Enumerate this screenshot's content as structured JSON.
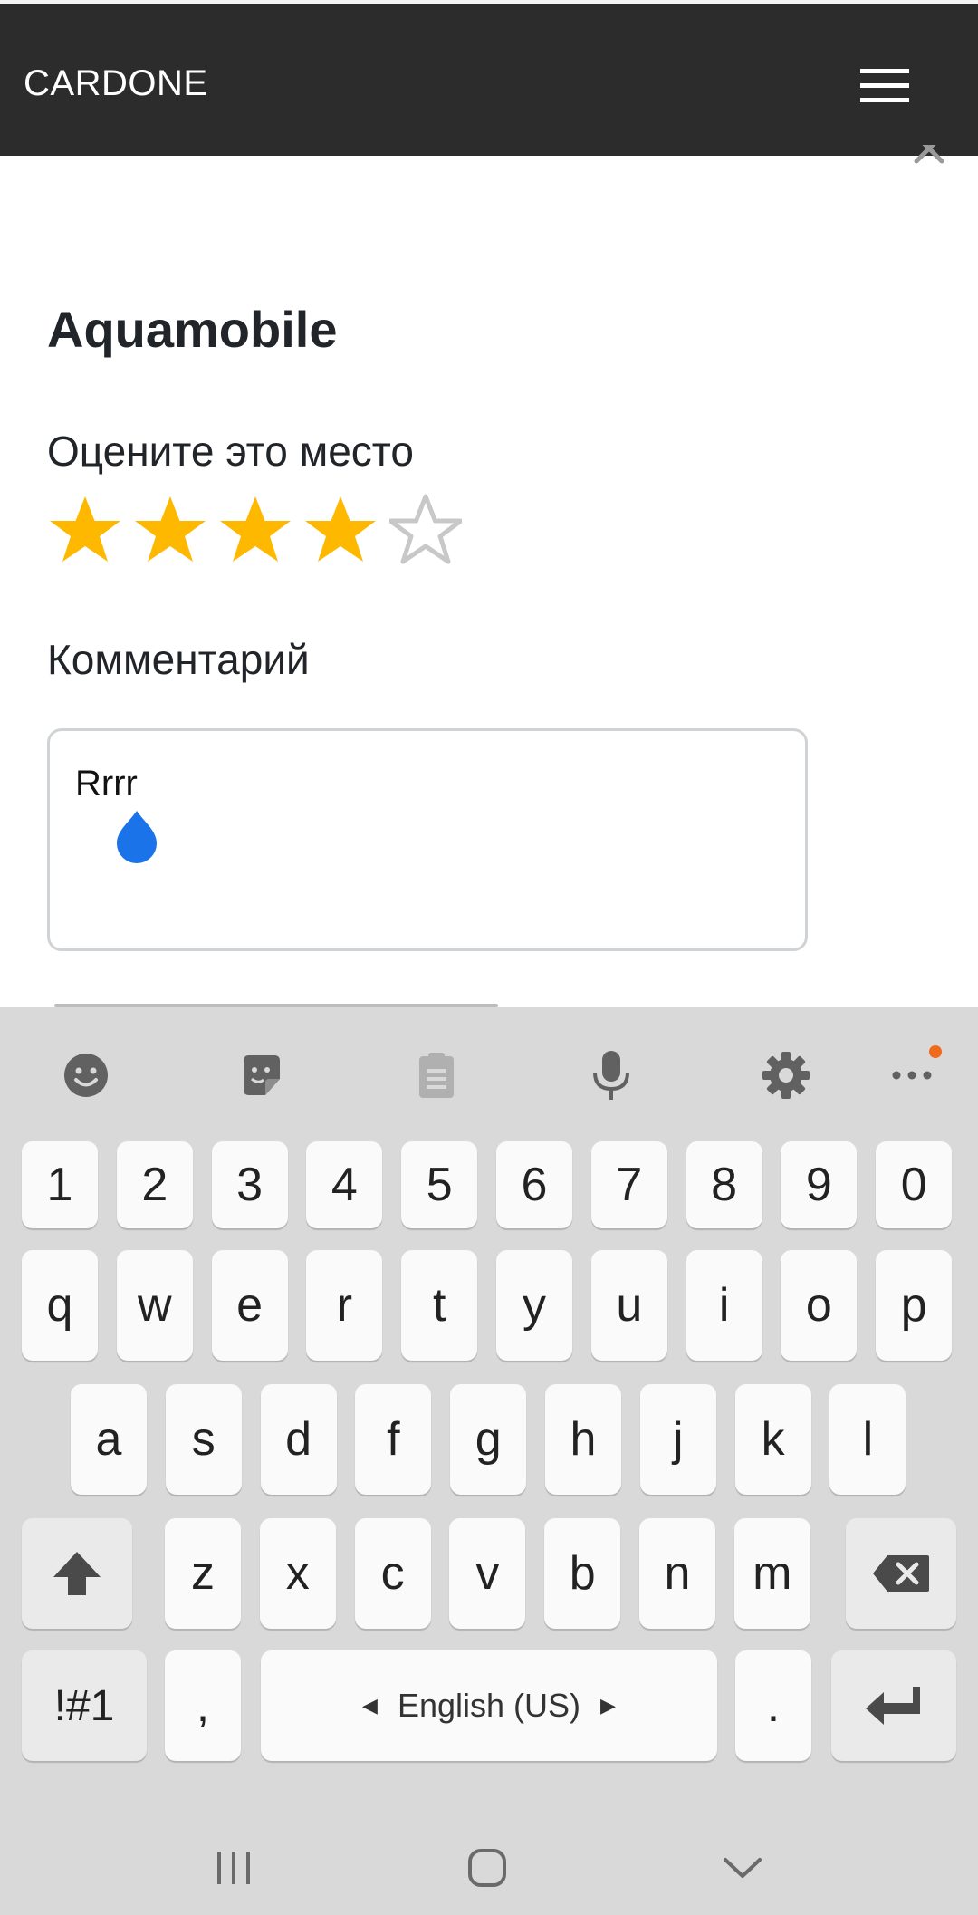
{
  "header": {
    "brand": "CARDONE",
    "menu_icon": "hamburger-menu-icon"
  },
  "modal": {
    "close_icon": "close-icon",
    "title": "Aquamobile",
    "rating_label": "Оцените это место",
    "rating": {
      "value": 4,
      "max": 5
    },
    "comment_label": "Комментарий",
    "comment_value": "Rrrr"
  },
  "colors": {
    "navbar": "#2c2c2c",
    "star_filled": "#ffb800",
    "star_empty": "#c8c8c8",
    "caret_handle": "#1a73e8",
    "keyboard_bg": "#d9d9d9"
  },
  "keyboard": {
    "toolbar": [
      "emoji-icon",
      "sticker-icon",
      "clipboard-icon",
      "microphone-icon",
      "settings-gear-icon",
      "more-options-icon"
    ],
    "number_row": [
      "1",
      "2",
      "3",
      "4",
      "5",
      "6",
      "7",
      "8",
      "9",
      "0"
    ],
    "row1": [
      "q",
      "w",
      "e",
      "r",
      "t",
      "y",
      "u",
      "i",
      "o",
      "p"
    ],
    "row2": [
      "a",
      "s",
      "d",
      "f",
      "g",
      "h",
      "j",
      "k",
      "l"
    ],
    "row3": [
      "z",
      "x",
      "c",
      "v",
      "b",
      "n",
      "m"
    ],
    "symbols_key": "!#1",
    "comma_key": ",",
    "space_label": "English (US)",
    "period_key": "."
  },
  "system_nav": [
    "recent-apps-icon",
    "home-icon",
    "back-icon"
  ]
}
